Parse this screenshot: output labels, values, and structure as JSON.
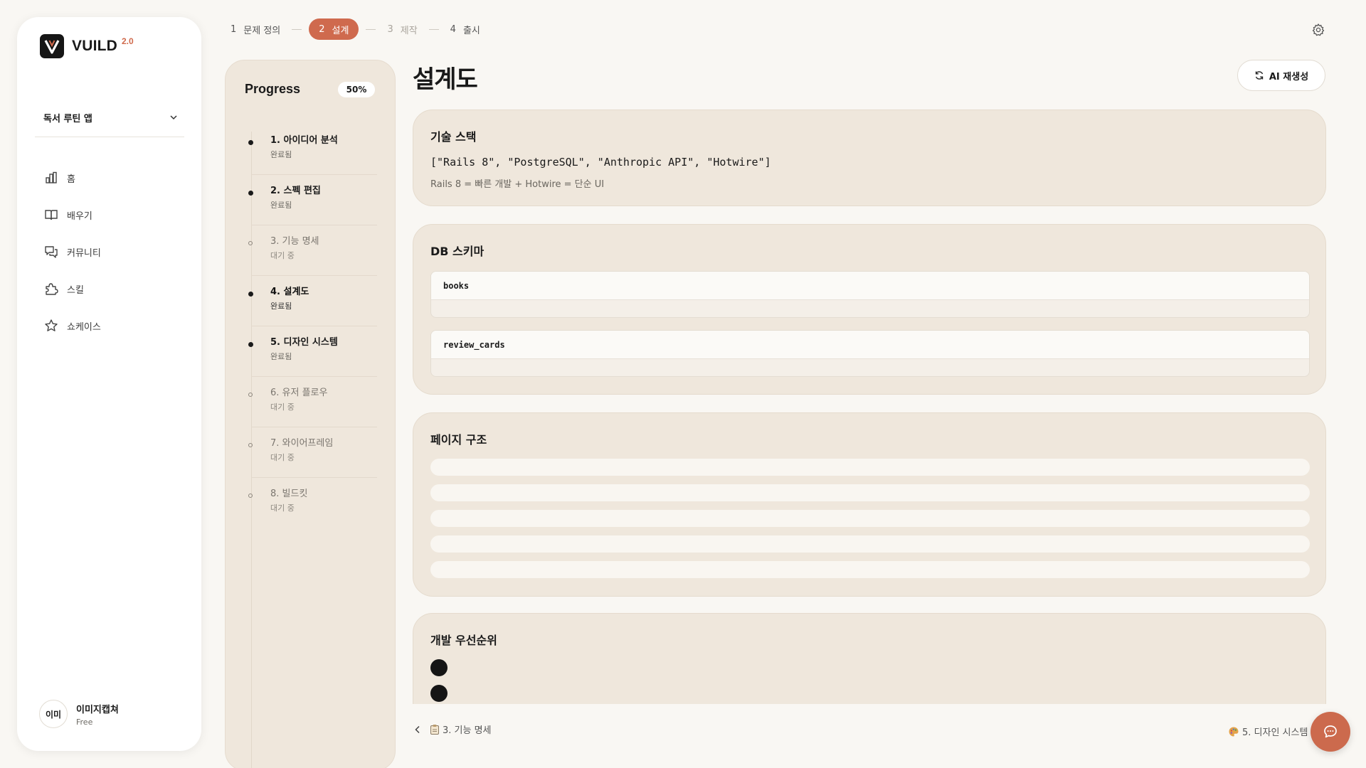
{
  "brand": {
    "name": "VUILD",
    "version": "2.0"
  },
  "project_select": {
    "value": "독서 루틴 앱"
  },
  "nav": [
    {
      "label": "홈",
      "icon": "chart-bar-icon"
    },
    {
      "label": "배우기",
      "icon": "book-icon"
    },
    {
      "label": "커뮤니티",
      "icon": "chat-bubbles-icon"
    },
    {
      "label": "스킬",
      "icon": "puzzle-icon"
    },
    {
      "label": "쇼케이스",
      "icon": "star-icon"
    }
  ],
  "user": {
    "avatar_text": "이미",
    "name": "이미지캡쳐",
    "plan": "Free"
  },
  "stepper": [
    {
      "num": "1",
      "label": "문제 정의"
    },
    {
      "num": "2",
      "label": "설계"
    },
    {
      "num": "3",
      "label": "제작"
    },
    {
      "num": "4",
      "label": "출시"
    }
  ],
  "progress": {
    "title": "Progress",
    "percent_label": "50%",
    "items": [
      {
        "label": "1. 아이디어 분석",
        "status": "완료됨"
      },
      {
        "label": "2. 스펙 편집",
        "status": "완료됨"
      },
      {
        "label": "3. 기능 명세",
        "status": "대기 중"
      },
      {
        "label": "4. 설계도",
        "status": "완료됨"
      },
      {
        "label": "5. 디자인 시스템",
        "status": "완료됨"
      },
      {
        "label": "6. 유저 플로우",
        "status": "대기 중"
      },
      {
        "label": "7. 와이어프레임",
        "status": "대기 중"
      },
      {
        "label": "8. 빌드킷",
        "status": "대기 중"
      }
    ]
  },
  "main": {
    "title": "설계도",
    "regen_label": "AI 재생성",
    "tech": {
      "title": "기술 스택",
      "code": "[\"Rails 8\", \"PostgreSQL\", \"Anthropic API\", \"Hotwire\"]",
      "note": "Rails 8 = 빠른 개발 + Hotwire = 단순 UI"
    },
    "db": {
      "title": "DB 스키마",
      "tables": [
        "books",
        "review_cards"
      ]
    },
    "pages": {
      "title": "페이지 구조"
    },
    "priority": {
      "title": "개발 우선순위"
    }
  },
  "footer": {
    "prev_label": "3. 기능 명세",
    "next_label": "5. 디자인 시스템"
  },
  "colors": {
    "accent": "#cf6a4e",
    "card_bg": "#efe7dc",
    "page_bg": "#f9f7f3"
  }
}
